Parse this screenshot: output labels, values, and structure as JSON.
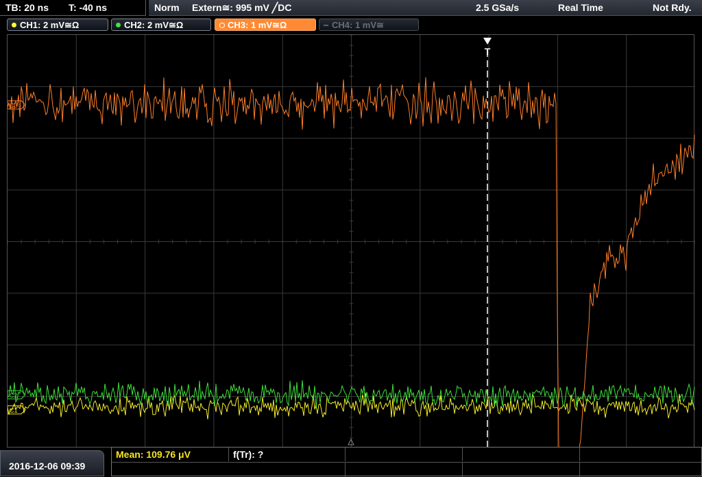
{
  "topbar": {
    "timebase": "TB: 20 ns",
    "trigger_time": "T: -40 ns",
    "mode": "Norm",
    "source": "Extern≅: 995 mV ╱DC",
    "sample_rate": "2.5 GSa/s",
    "acq_mode": "Real Time",
    "status": "Not Rdy."
  },
  "channels": [
    {
      "label": "CH1: 2 mV≅Ω",
      "color": "#ffff30",
      "active": false
    },
    {
      "label": "CH2: 2 mV≅Ω",
      "color": "#44e044",
      "active": false
    },
    {
      "label": "CH3: 1 mV≅Ω",
      "color": "#ff8a33",
      "active": true
    },
    {
      "label": "CH4: 1 mV≅",
      "color": "#5a5e66",
      "active": false
    }
  ],
  "markers": {
    "trigger": "T",
    "ch3": "C3",
    "ch2": "C2",
    "ch1": "C1"
  },
  "bottom": {
    "datetime": "2016-12-06 09:39",
    "mean": "Mean: 109.76 μV",
    "ftr": "f(Tr): ?"
  },
  "colors": {
    "ch1": "#f5ee2a",
    "ch2": "#3fe03a",
    "ch3": "#ff7f2a",
    "grid": "#3a3a3a"
  }
}
